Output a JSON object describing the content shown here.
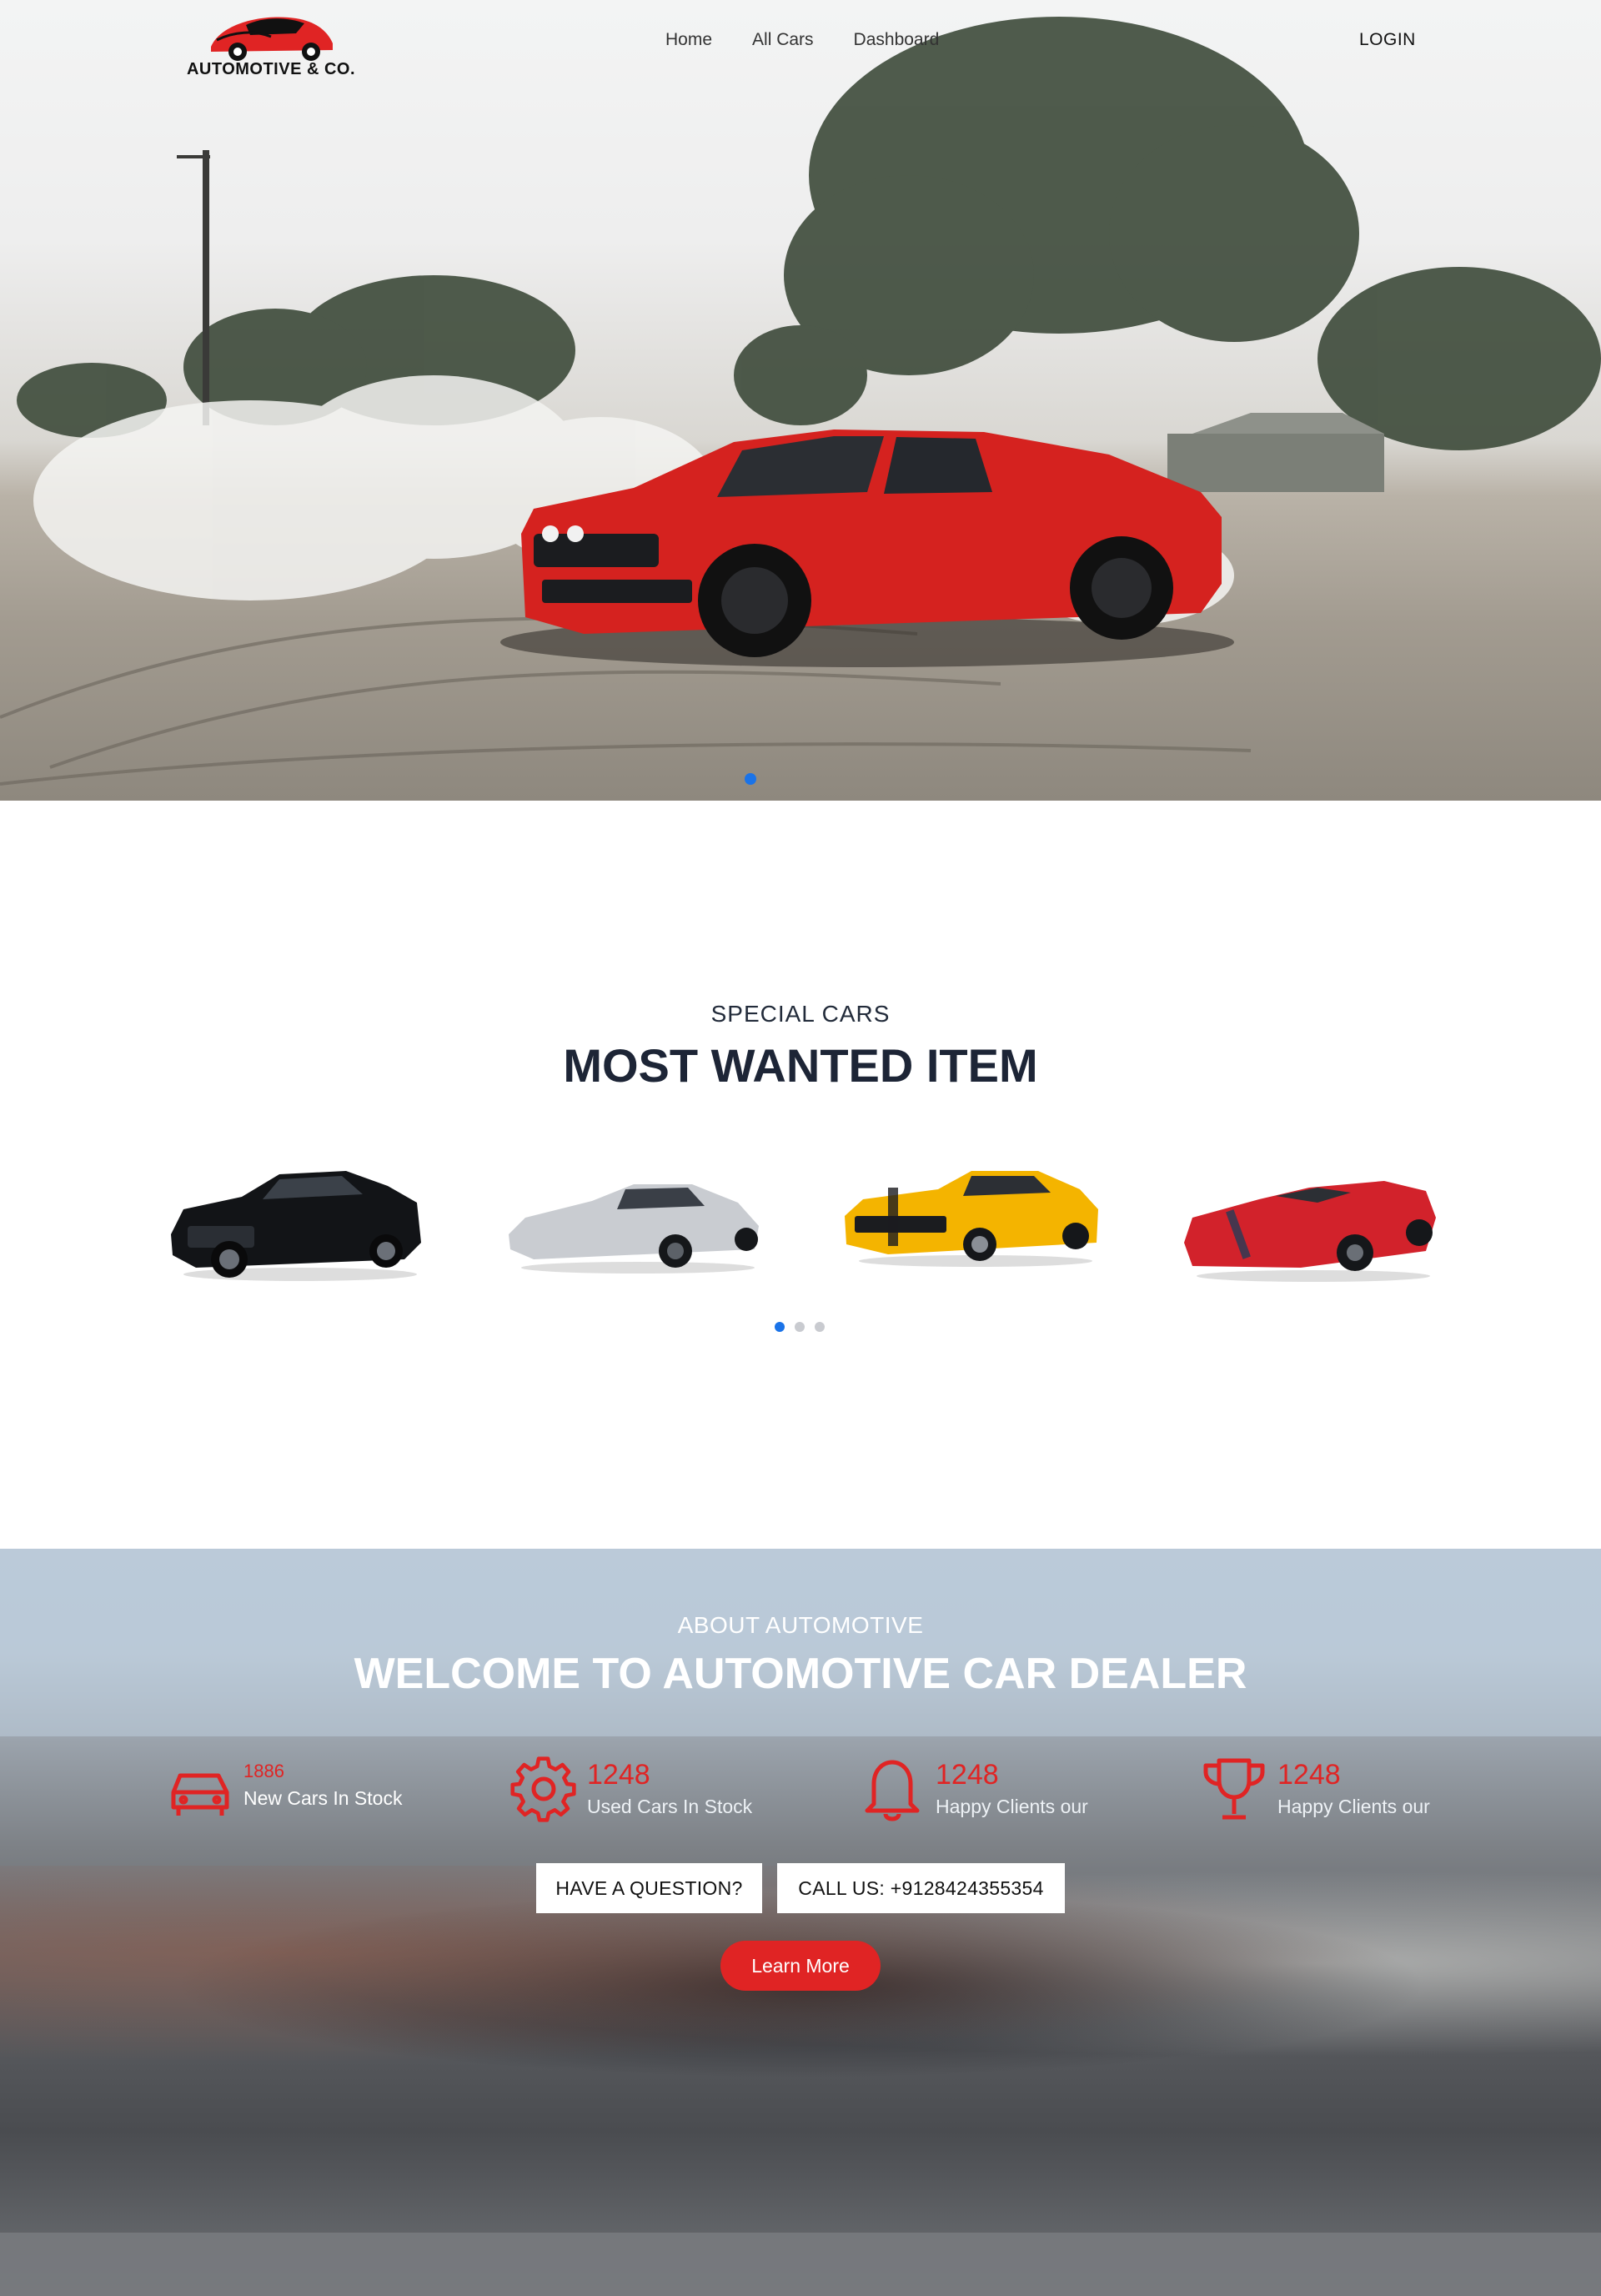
{
  "brand": {
    "name": "AUTOMOTIVE & CO.",
    "accent": "#e02424",
    "primary": "#1a73e8"
  },
  "nav": {
    "links": [
      "Home",
      "All Cars",
      "Dashboard"
    ],
    "login": "LOGIN"
  },
  "hero": {
    "slide_count": 1,
    "active_slide": 1
  },
  "special": {
    "subtitle": "SPECIAL CARS",
    "title": "MOST WANTED ITEM",
    "cars": [
      {
        "color": "#121417",
        "icon": "black-sedan-image"
      },
      {
        "color": "#c9ccd1",
        "icon": "silver-supercar-image"
      },
      {
        "color": "#f4b400",
        "icon": "yellow-muscle-car-image"
      },
      {
        "color": "#d2222b",
        "icon": "red-convertible-image"
      }
    ],
    "dots": 3,
    "active_dot": 1
  },
  "about": {
    "subtitle": "ABOUT AUTOMOTIVE",
    "title": "WELCOME TO AUTOMOTIVE CAR DEALER",
    "stats": [
      {
        "icon": "car-icon",
        "number": "1886",
        "label": "New Cars In Stock"
      },
      {
        "icon": "gear-icon",
        "number": "1248",
        "label": "Used Cars In Stock"
      },
      {
        "icon": "bell-icon",
        "number": "1248",
        "label": "Happy Clients our"
      },
      {
        "icon": "trophy-icon",
        "number": "1248",
        "label": "Happy Clients our"
      }
    ],
    "question_button": "HAVE A QUESTION?",
    "call_button": "CALL US: +9128424355354",
    "learn_more": "Learn More"
  }
}
